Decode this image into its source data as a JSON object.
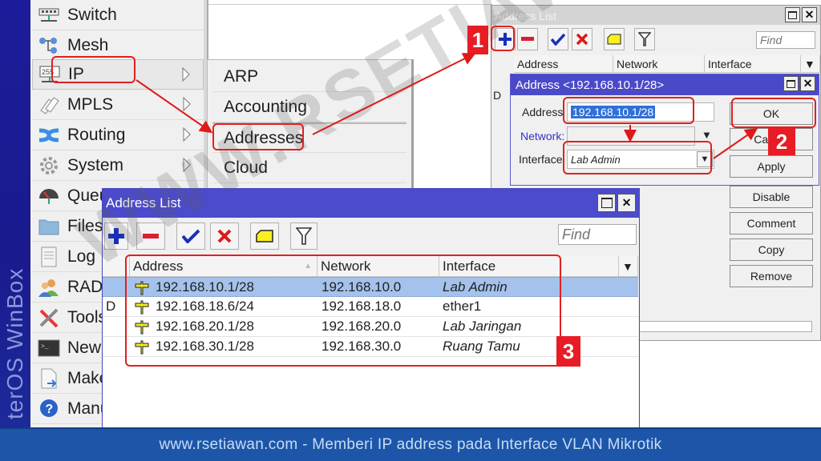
{
  "brand": {
    "text": "terOS WinBox"
  },
  "main_menu": {
    "items": [
      {
        "label": "Switch",
        "icon": "switch-icon",
        "has_submenu": false
      },
      {
        "label": "Mesh",
        "icon": "mesh-icon",
        "has_submenu": false
      },
      {
        "label": "IP",
        "icon": "ip-icon",
        "has_submenu": true,
        "active": true
      },
      {
        "label": "MPLS",
        "icon": "mpls-icon",
        "has_submenu": true
      },
      {
        "label": "Routing",
        "icon": "routing-icon",
        "has_submenu": true
      },
      {
        "label": "System",
        "icon": "gear-icon",
        "has_submenu": true
      },
      {
        "label": "Queu",
        "icon": "queue-icon",
        "has_submenu": false
      },
      {
        "label": "Files",
        "icon": "folder-icon",
        "has_submenu": false
      },
      {
        "label": "Log",
        "icon": "log-icon",
        "has_submenu": false
      },
      {
        "label": "RAD",
        "icon": "radius-icon",
        "has_submenu": false
      },
      {
        "label": "Tools",
        "icon": "tools-icon",
        "has_submenu": false
      },
      {
        "label": "New",
        "icon": "terminal-icon",
        "has_submenu": false
      },
      {
        "label": "Make",
        "icon": "make-supout-icon",
        "has_submenu": false
      },
      {
        "label": "Manu",
        "icon": "help-icon",
        "has_submenu": false
      }
    ]
  },
  "ip_submenu": {
    "items": [
      {
        "label": "ARP"
      },
      {
        "label": "Accounting"
      },
      {
        "label": "Addresses",
        "highlighted": true
      },
      {
        "label": "Cloud"
      }
    ]
  },
  "back_window": {
    "title": "Address List",
    "find_placeholder": "Find",
    "columns": [
      "Address",
      "Network",
      "Interface"
    ],
    "row_flag": "D"
  },
  "dialog": {
    "title": "Address <192.168.10.1/28>",
    "address_label": "Address",
    "address_value": "192.168.10.1/28",
    "network_label": "Network:",
    "network_value": "",
    "interface_label": "Interface",
    "interface_value": "Lab Admin",
    "buttons": [
      "OK",
      "Cancel",
      "Apply",
      "Disable",
      "Comment",
      "Copy",
      "Remove"
    ]
  },
  "front_window": {
    "title": "Address List",
    "find_placeholder": "Find",
    "toolbar": [
      "add",
      "remove",
      "enable",
      "disable",
      "comment",
      "filter"
    ],
    "columns": [
      "Address",
      "Network",
      "Interface"
    ],
    "rows": [
      {
        "flag": "",
        "address": "192.168.10.1/28",
        "network": "192.168.10.0",
        "interface": "Lab Admin",
        "italic": true,
        "selected": true
      },
      {
        "flag": "D",
        "address": "192.168.18.6/24",
        "network": "192.168.18.0",
        "interface": "ether1",
        "italic": false,
        "selected": false
      },
      {
        "flag": "",
        "address": "192.168.20.1/28",
        "network": "192.168.20.0",
        "interface": "Lab Jaringan",
        "italic": true,
        "selected": false
      },
      {
        "flag": "",
        "address": "192.168.30.1/28",
        "network": "192.168.30.0",
        "interface": "Ruang Tamu",
        "italic": true,
        "selected": false
      }
    ]
  },
  "annotations": {
    "step1": "1",
    "step2": "2",
    "step3": "3",
    "color": "#e81c24"
  },
  "watermark": "WWW.RSETIAWAN.COM",
  "footer": {
    "caption": "www.rsetiawan.com - Memberi IP address pada Interface VLAN Mikrotik"
  }
}
